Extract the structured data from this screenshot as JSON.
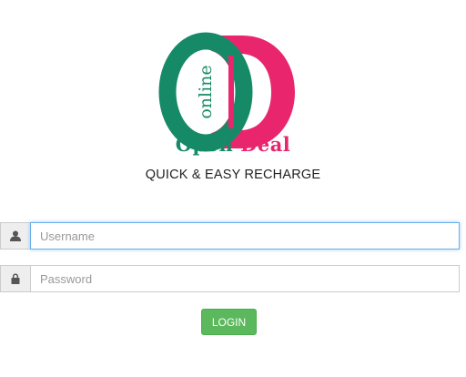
{
  "logo": {
    "emblem_text": "online",
    "brand_word_1": "Open",
    "brand_word_2": "Deal",
    "color_green": "#168a67",
    "color_pink": "#e8256d"
  },
  "tagline": "QUICK & EASY RECHARGE",
  "form": {
    "username": {
      "placeholder": "Username",
      "value": "",
      "icon": "user-icon"
    },
    "password": {
      "placeholder": "Password",
      "value": "",
      "icon": "lock-icon"
    },
    "login_label": "LOGIN",
    "login_color": "#5cb85c"
  }
}
